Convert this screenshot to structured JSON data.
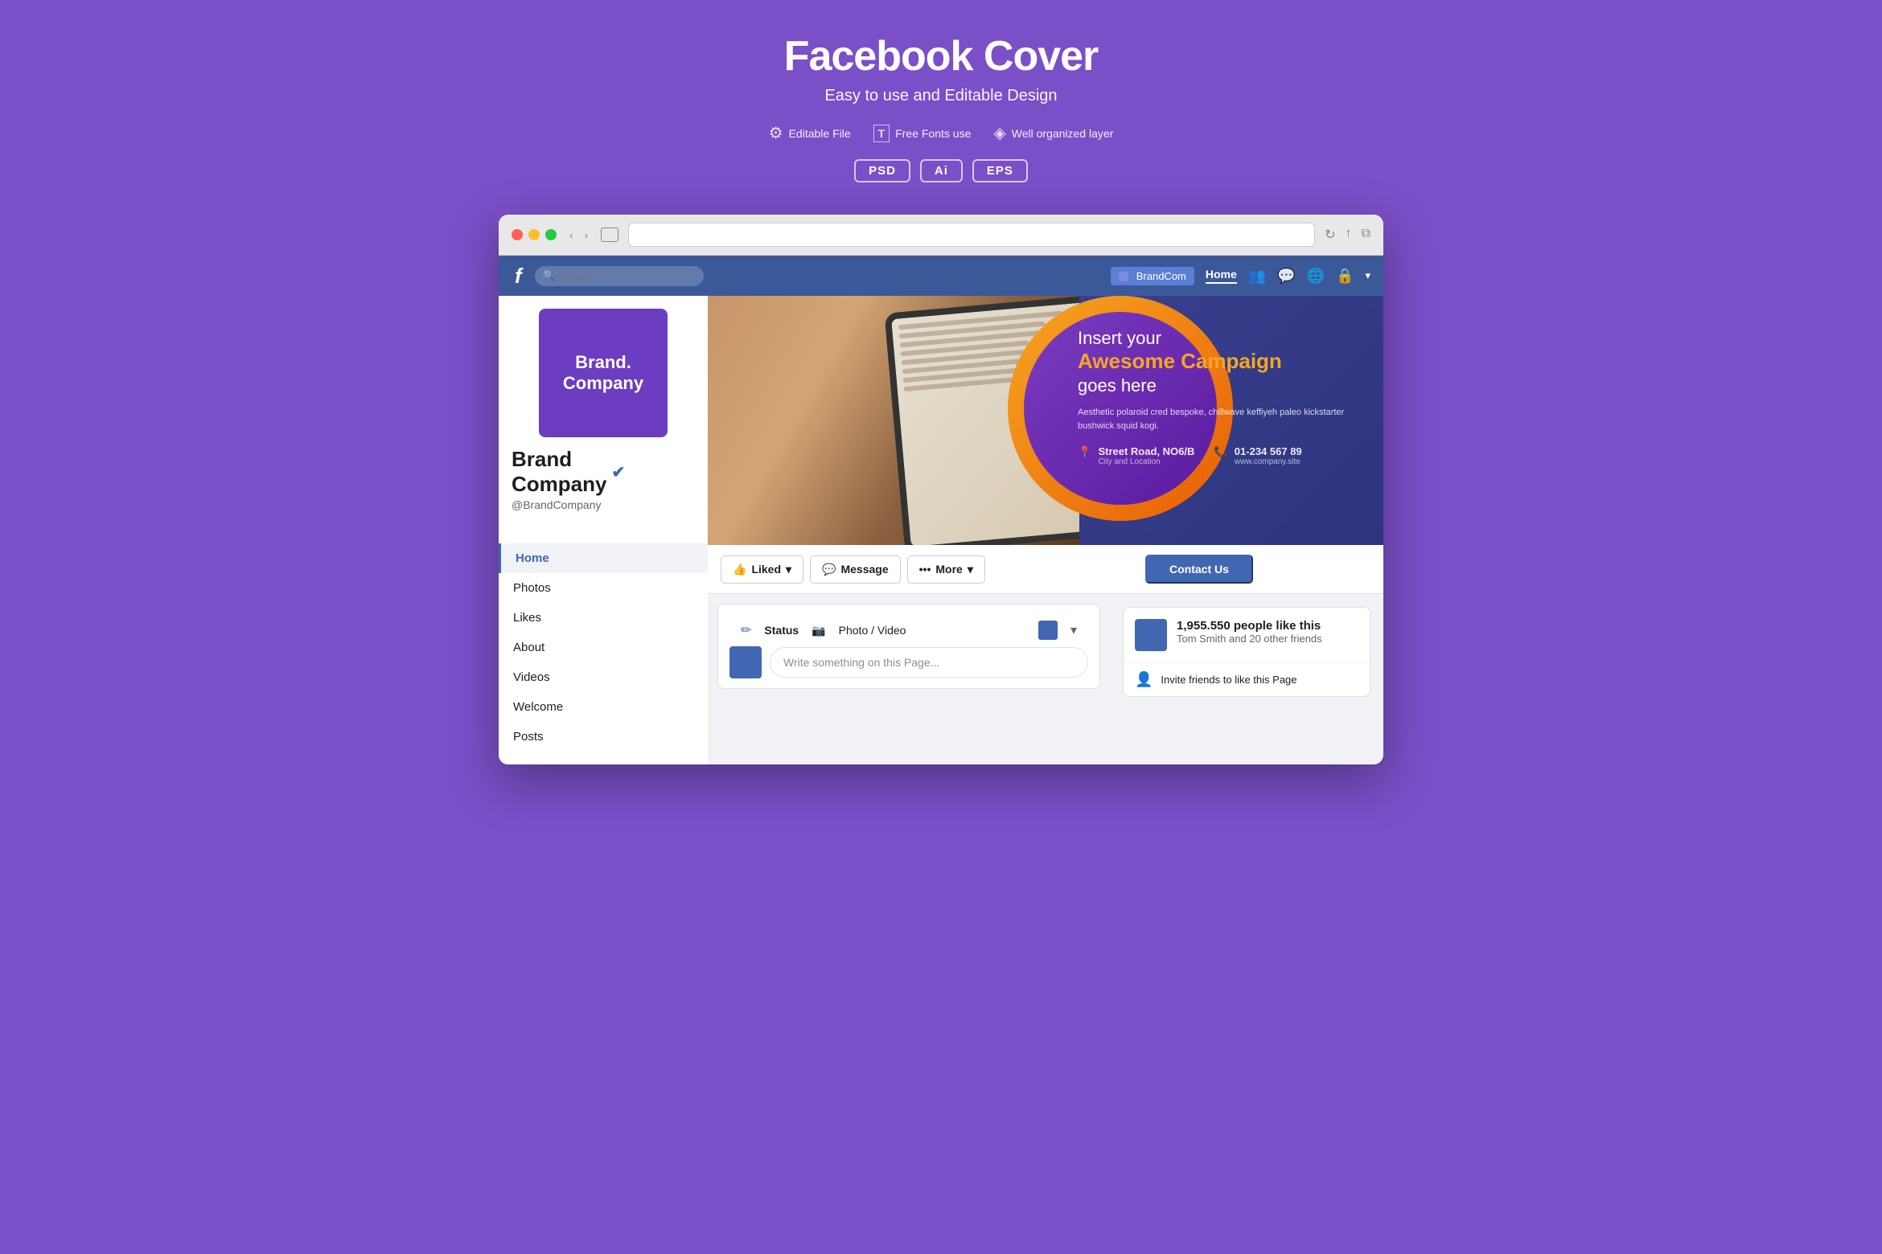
{
  "header": {
    "title": "Facebook Cover",
    "subtitle": "Easy to use and Editable Design",
    "features": [
      {
        "icon": "⚙",
        "label": "Editable File"
      },
      {
        "icon": "T",
        "label": "Free Fonts use"
      },
      {
        "icon": "◈",
        "label": "Well organized layer"
      }
    ],
    "badges": [
      "PSD",
      "Ai",
      "EPS"
    ]
  },
  "browser": {
    "address": ""
  },
  "facebook": {
    "logo": "f",
    "search_placeholder": "Search",
    "brand_name": "BrandCom",
    "home_label": "Home",
    "profile": {
      "name": "Brand\nCompany",
      "display_name": "Brand Company",
      "handle": "@BrandCompany",
      "logo_text": "Brand.\nCompany",
      "verified": true
    },
    "nav_items": [
      "Home",
      "Photos",
      "Likes",
      "About",
      "Videos",
      "Welcome",
      "Posts"
    ],
    "cover": {
      "headline1": "Insert your",
      "headline2": "Awesome Campaign",
      "headline3": "goes here",
      "description": "Aesthetic polaroid cred bespoke, chillwave keffiyeh\npaleo kickstarter bushwick squid kogi.",
      "address_label": "Street Road, NO6/B",
      "address_sub": "City and Location",
      "phone": "01-234 567 89",
      "website": "www.company.site"
    },
    "action_bar": {
      "liked_btn": "Liked",
      "message_btn": "Message",
      "more_btn": "More",
      "contact_btn": "Contact Us"
    },
    "post_area": {
      "status_label": "Status",
      "photo_video_label": "Photo / Video",
      "placeholder": "Write something on this Page..."
    },
    "likes_widget": {
      "count": "1,955.550 people like this",
      "friends": "Tom Smith and 20 other friends",
      "invite_text": "Invite friends to like this Page"
    }
  }
}
